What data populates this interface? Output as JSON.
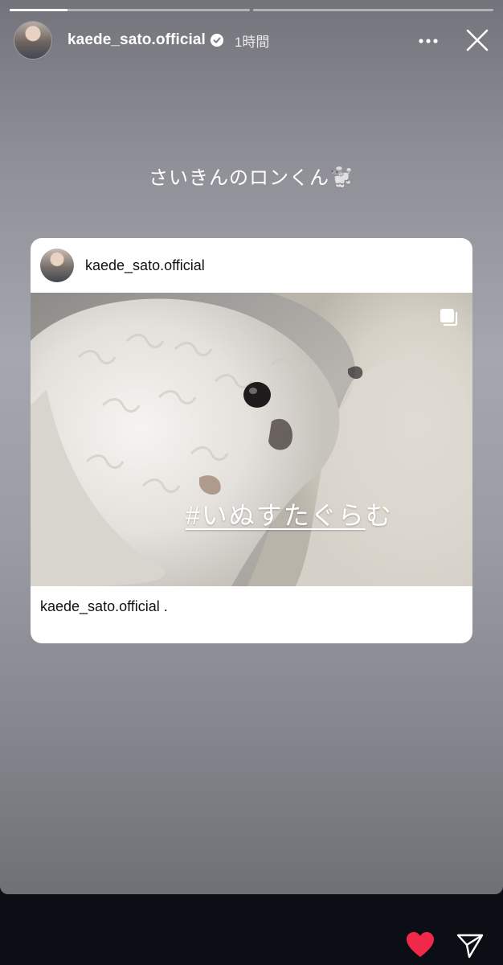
{
  "story": {
    "progress": [
      {
        "fill": 0.24
      },
      {
        "fill": 0.0
      }
    ]
  },
  "header": {
    "username": "kaede_sato.official",
    "time_ago": "1時間",
    "verified_icon": "verified-badge-icon",
    "more_icon": "more-dots-icon",
    "close_icon": "close-icon"
  },
  "caption": {
    "text": "さいきんのロンくん🐩"
  },
  "shared_post": {
    "username": "kaede_sato.official",
    "hashtag_underlined": "#いぬすたぐら",
    "hashtag_rest": "む",
    "multi_photo_icon": "carousel-icon",
    "caption_user": "kaede_sato.official",
    "caption_text": " ."
  },
  "bottom_bar": {
    "like_icon": "heart-icon",
    "like_color": "#f02849",
    "share_icon": "send-icon"
  }
}
